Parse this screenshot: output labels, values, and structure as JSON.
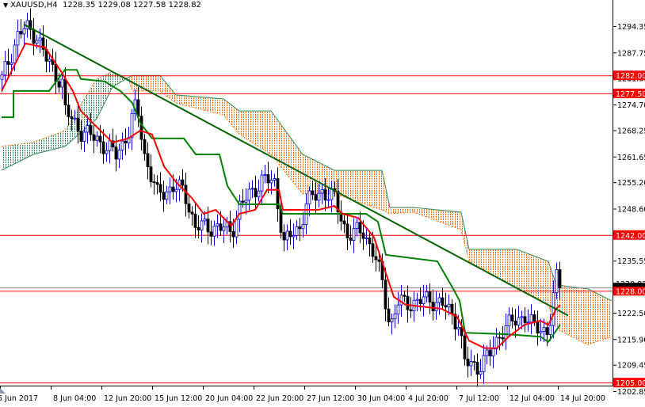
{
  "header": {
    "symbol": "XAUUSD,H4",
    "ohlc": "1228.35 1229.08 1227.58 1228.82",
    "menu_icon": "triangle-down-icon"
  },
  "colors": {
    "horizontal_lines": "#ff0000",
    "trendline": "#006400",
    "tenkan": "#ff0000",
    "kijun": "#008000",
    "cloud_bull": "#2e8b57",
    "cloud_bear": "#ff6a00",
    "label_bg": "#ff0000",
    "bid_line": "#8c8c8c"
  },
  "chart_data": {
    "type": "candlestick",
    "title": "XAUUSD,H4",
    "ylim": [
      1202.85,
      1294.35
    ],
    "y_ticks": [
      "1294.35",
      "1287.75",
      "1281.30",
      "1274.70",
      "1268.25",
      "1261.65",
      "1255.20",
      "1248.60",
      "1235.55",
      "1222.50",
      "1215.90",
      "1209.45",
      "1202.85"
    ],
    "x_ticks": [
      {
        "bar": 0,
        "label": "5 Jun 2017"
      },
      {
        "bar": 16,
        "label": "8 Jun 04:00"
      },
      {
        "bar": 32,
        "label": "12 Jun 20:00"
      },
      {
        "bar": 48,
        "label": "15 Jun 12:00"
      },
      {
        "bar": 64,
        "label": "20 Jun 04:00"
      },
      {
        "bar": 80,
        "label": "22 Jun 20:00"
      },
      {
        "bar": 96,
        "label": "27 Jun 12:00"
      },
      {
        "bar": 112,
        "label": "30 Jun 04:00"
      },
      {
        "bar": 128,
        "label": "4 Jul 20:00"
      },
      {
        "bar": 144,
        "label": "7 Jul 12:00"
      },
      {
        "bar": 160,
        "label": "12 Jul 04:00"
      },
      {
        "bar": 176,
        "label": "14 Jul 20:00"
      }
    ],
    "bars": 177,
    "price_path": [
      [
        0,
        1281
      ],
      [
        5,
        1292
      ],
      [
        7.5,
        1294
      ],
      [
        11,
        1292
      ],
      [
        14,
        1286
      ],
      [
        19,
        1280
      ],
      [
        20,
        1273
      ],
      [
        25,
        1268
      ],
      [
        30,
        1266
      ],
      [
        36,
        1262
      ],
      [
        40,
        1268
      ],
      [
        42.5,
        1275
      ],
      [
        45,
        1262
      ],
      [
        49,
        1252
      ],
      [
        54,
        1254
      ],
      [
        57.5,
        1253
      ],
      [
        61,
        1244
      ],
      [
        67.5,
        1244
      ],
      [
        72.5,
        1243
      ],
      [
        75,
        1249
      ],
      [
        79,
        1253
      ],
      [
        82.5,
        1256
      ],
      [
        86,
        1255
      ],
      [
        89,
        1240
      ],
      [
        94,
        1244
      ],
      [
        96,
        1250
      ],
      [
        101,
        1253
      ],
      [
        105,
        1251
      ],
      [
        109,
        1242
      ],
      [
        114,
        1243
      ],
      [
        117.5,
        1237
      ],
      [
        120,
        1230
      ],
      [
        122.5,
        1219
      ],
      [
        125,
        1225
      ],
      [
        130,
        1225
      ],
      [
        135,
        1226
      ],
      [
        140,
        1224
      ],
      [
        144,
        1220
      ],
      [
        146,
        1210
      ],
      [
        150,
        1209
      ],
      [
        154,
        1212
      ],
      [
        157.5,
        1218
      ],
      [
        161,
        1220
      ],
      [
        165,
        1222
      ],
      [
        167.5,
        1219
      ],
      [
        172.5,
        1218
      ],
      [
        175,
        1231
      ],
      [
        176.5,
        1228.82
      ]
    ],
    "tenkan": [
      [
        0,
        1278.1
      ],
      [
        7.5,
        1290.0
      ],
      [
        13.75,
        1289.0
      ],
      [
        18.75,
        1283.0
      ],
      [
        22.5,
        1278.1
      ],
      [
        25,
        1273.1
      ],
      [
        30,
        1269.1
      ],
      [
        35,
        1265.2
      ],
      [
        40,
        1266.2
      ],
      [
        43.75,
        1268.2
      ],
      [
        47.5,
        1267.2
      ],
      [
        51.25,
        1259.2
      ],
      [
        55,
        1255.3
      ],
      [
        60,
        1251.3
      ],
      [
        63.75,
        1247.3
      ],
      [
        67.5,
        1248.3
      ],
      [
        72.5,
        1244.3
      ],
      [
        75,
        1247.3
      ],
      [
        80,
        1248.3
      ],
      [
        83.75,
        1253.3
      ],
      [
        87.5,
        1253.3
      ],
      [
        88.75,
        1248.3
      ],
      [
        100,
        1248.3
      ],
      [
        105,
        1249.3
      ],
      [
        107.5,
        1247.3
      ],
      [
        112.5,
        1246.3
      ],
      [
        117.5,
        1241.4
      ],
      [
        121.25,
        1232.4
      ],
      [
        123.75,
        1226.5
      ],
      [
        127.5,
        1224.5
      ],
      [
        138.75,
        1223.5
      ],
      [
        143.75,
        1221.5
      ],
      [
        147.5,
        1215.5
      ],
      [
        152.5,
        1213.6
      ],
      [
        156.25,
        1213.6
      ],
      [
        160,
        1216.5
      ],
      [
        165,
        1219.5
      ],
      [
        170,
        1220.5
      ],
      [
        172.5,
        1219.5
      ],
      [
        175,
        1223.5
      ],
      [
        176.25,
        1224.5
      ]
    ],
    "kijun": [
      [
        0,
        1271.5
      ],
      [
        3.75,
        1271.5
      ],
      [
        3.75,
        1278.1
      ],
      [
        15,
        1278.1
      ],
      [
        20,
        1283.4
      ],
      [
        23.75,
        1283.4
      ],
      [
        25,
        1281.1
      ],
      [
        32.5,
        1280.5
      ],
      [
        37.5,
        1278.1
      ],
      [
        41.25,
        1275.1
      ],
      [
        43.75,
        1270.1
      ],
      [
        47.5,
        1266.2
      ],
      [
        57.5,
        1266.2
      ],
      [
        61.25,
        1262.2
      ],
      [
        68.75,
        1262.2
      ],
      [
        71.25,
        1254.3
      ],
      [
        75,
        1249.7
      ],
      [
        87.5,
        1249.7
      ],
      [
        88.75,
        1247.3
      ],
      [
        115,
        1247.3
      ],
      [
        118.75,
        1245.3
      ],
      [
        121.25,
        1237.0
      ],
      [
        137.5,
        1235.4
      ],
      [
        142.5,
        1228.5
      ],
      [
        144.5,
        1225.5
      ],
      [
        146.25,
        1217.5
      ],
      [
        160,
        1217.1
      ],
      [
        170,
        1216.5
      ],
      [
        172.5,
        1215.2
      ],
      [
        176.25,
        1219.5
      ]
    ],
    "cloud": [
      [
        0,
        1264.2,
        1258.2
      ],
      [
        10,
        1265.2,
        1262.2
      ],
      [
        20,
        1268.2,
        1264.2
      ],
      [
        30,
        1281.1,
        1271.1
      ],
      [
        35,
        1283.0,
        1279.1
      ],
      [
        40,
        1281.1,
        1281.5
      ],
      [
        41.25,
        1278.1,
        1282.0
      ],
      [
        50,
        1278.1,
        1282.0
      ],
      [
        55,
        1275.1,
        1277.1
      ],
      [
        70,
        1272.1,
        1276.1
      ],
      [
        75,
        1267.2,
        1273.1
      ],
      [
        85,
        1262.2,
        1273.1
      ],
      [
        95,
        1252.3,
        1262.2
      ],
      [
        105,
        1252.3,
        1258.2
      ],
      [
        120,
        1248.3,
        1258.2
      ],
      [
        122.5,
        1247.3,
        1248.9
      ],
      [
        130,
        1247.7,
        1248.9
      ],
      [
        145,
        1243.3,
        1247.7
      ],
      [
        147.5,
        1235.4,
        1238.4
      ],
      [
        162.5,
        1228.5,
        1238.4
      ],
      [
        172.5,
        1224.5,
        1235.4
      ],
      [
        175,
        1218.5,
        1229.5
      ],
      [
        185,
        1214.5,
        1228.5
      ],
      [
        192.5,
        1216.5,
        1225.5
      ]
    ],
    "trendline": [
      [
        7,
        1294.8
      ],
      [
        178.75,
        1221.8
      ]
    ],
    "levels": [
      {
        "price": 1282.0,
        "label": "1282.00"
      },
      {
        "price": 1277.5,
        "label": "1277.50"
      },
      {
        "price": 1242.0,
        "label": "1242.00"
      },
      {
        "price": 1228.0,
        "label": "1228.00"
      },
      {
        "price": 1205.0,
        "label": "1205.00"
      }
    ],
    "bid": {
      "price": 1228.82,
      "label": "1228.82"
    }
  }
}
